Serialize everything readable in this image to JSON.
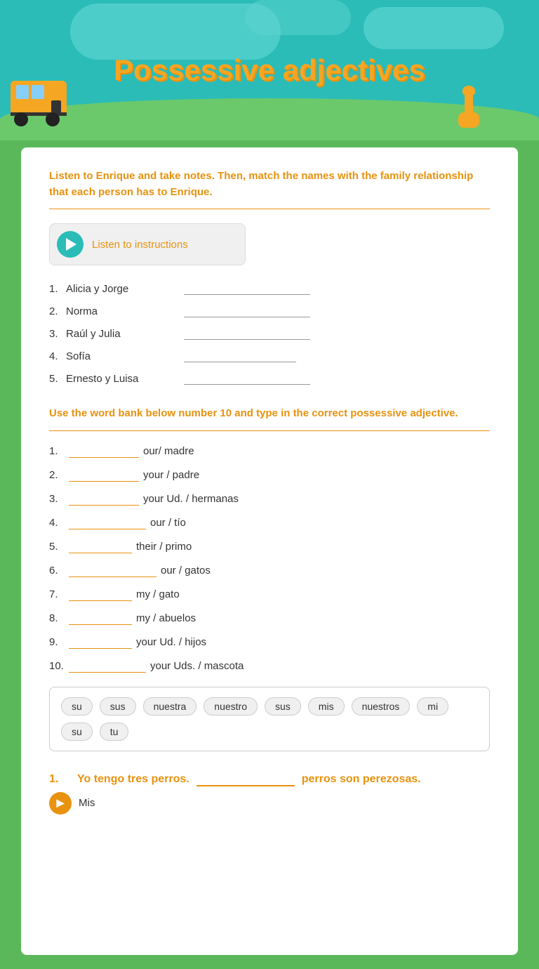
{
  "header": {
    "title": "Possessive adjectives"
  },
  "section1": {
    "instruction": "Listen to Enrique and take notes.   Then, match the names with the family relationship that each person has to Enrique.",
    "audio_label": "Listen to instructions",
    "names": [
      {
        "num": "1.",
        "name": "Alicia y Jorge"
      },
      {
        "num": "2.",
        "name": "Norma"
      },
      {
        "num": "3.",
        "name": "Raúl y Julia"
      },
      {
        "num": "4.",
        "name": "Sofía"
      },
      {
        "num": "5.",
        "name": "Ernesto y Luisa"
      }
    ]
  },
  "section2": {
    "instruction": "Use the word bank below number 10 and type in the correct possessive adjective.",
    "items": [
      {
        "num": "1.",
        "blank_width": "100",
        "label": "our/ madre"
      },
      {
        "num": "2.",
        "blank_width": "100",
        "label": "your / padre"
      },
      {
        "num": "3.",
        "blank_width": "100",
        "label": "your Ud. / hermanas"
      },
      {
        "num": "4.",
        "blank_width": "110",
        "label": "our / tío"
      },
      {
        "num": "5.",
        "blank_width": "90",
        "label": "their / primo"
      },
      {
        "num": "6.",
        "blank_width": "125",
        "label": "our / gatos"
      },
      {
        "num": "7.",
        "blank_width": "90",
        "label": "my / gato"
      },
      {
        "num": "8.",
        "blank_width": "90",
        "label": "my / abuelos"
      },
      {
        "num": "9.",
        "blank_width": "90",
        "label": "your Ud. / hijos"
      },
      {
        "num": "10.",
        "blank_width": "110",
        "label": "your Uds. / mascota"
      }
    ],
    "word_bank": [
      "su",
      "sus",
      "nuestra",
      "nuestro",
      "sus",
      "mis",
      "nuestros",
      "mi",
      "su",
      "tu"
    ]
  },
  "section3": {
    "items": [
      {
        "num": "1.",
        "prefix": "Yo tengo tres perros.",
        "blank": "",
        "suffix": "perros son perezosas."
      }
    ],
    "hint_label": "Mis"
  }
}
